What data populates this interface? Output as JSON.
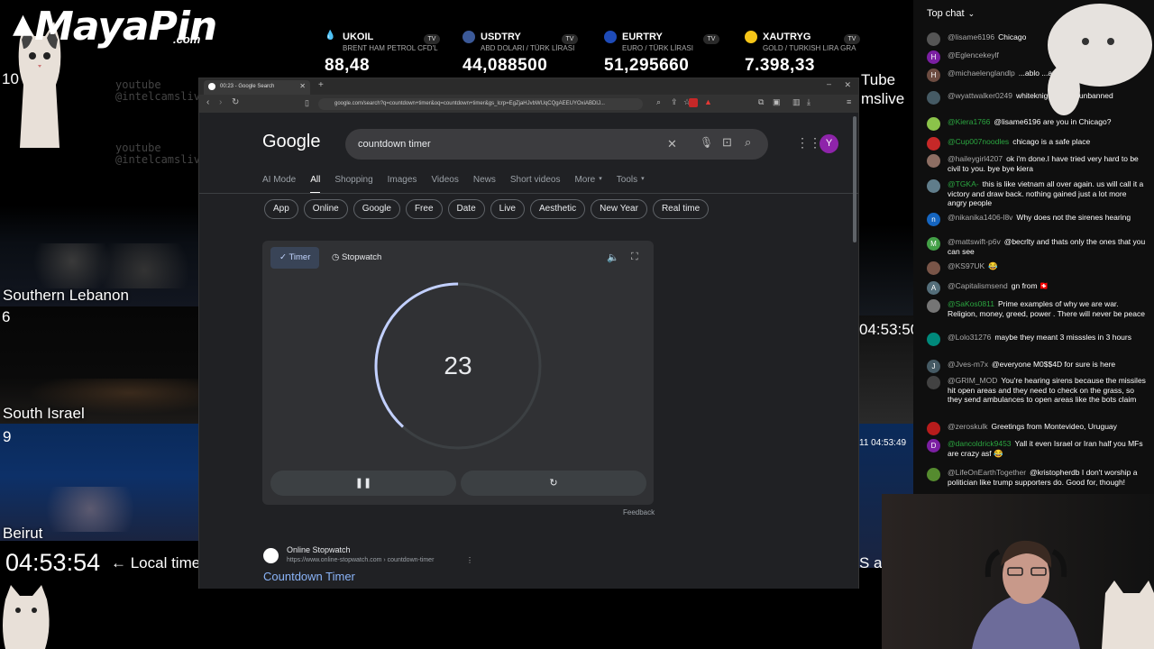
{
  "branding": {
    "logo": "MayaPin",
    "logo_suffix": ".com"
  },
  "ticker": [
    {
      "symbol": "UKOIL",
      "subtitle": "BRENT HAM PETROL CFD'L",
      "value": "88,48",
      "icon": "oil-drop-icon"
    },
    {
      "symbol": "USDTRY",
      "subtitle": "ABD DOLARI / TÜRK LİRASI",
      "value": "44,088500",
      "icon": "usd-try-flag-icon"
    },
    {
      "symbol": "EURTRY",
      "subtitle": "EURO / TÜRK LİRASI",
      "value": "51,295660",
      "icon": "eur-try-flag-icon"
    },
    {
      "symbol": "XAUTRYG",
      "subtitle": "GOLD / TURKISH LIRA GRA",
      "value": "7.398,33",
      "icon": "gold-coin-icon"
    }
  ],
  "cams": {
    "left_top_number": "10",
    "southern_lebanon": {
      "label": "Southern Lebanon",
      "number": "6"
    },
    "south_israel": {
      "label": "South Israel",
      "number": "9"
    },
    "beirut": {
      "label": "Beirut"
    },
    "local_time": "04:53:54",
    "local_time_label": "← Local time",
    "right_time_1": "04:53:50",
    "right_time_2": "11 04:53:49",
    "right_tube_text": "Tube",
    "right_live_text": "mslive",
    "right_bottom_text": "S a",
    "watermark": "youtube\n@intelcamslive"
  },
  "chat": {
    "header": "Top chat",
    "messages": [
      {
        "author": "@lisame6196",
        "text": "Chicago",
        "avatar": "",
        "color": "#555"
      },
      {
        "author": "@Eglencekeylf",
        "text": "",
        "avatar": "H",
        "color": "#7b1fa2"
      },
      {
        "author": "@michaelenglandlp",
        "text": "...ablo ...av-g6ln",
        "avatar": "H",
        "color": "#6d4c41"
      },
      {
        "author": "@wyattwalker0249",
        "text": "whiteknights k... n unbanned",
        "avatar": "",
        "color": "#455a64"
      },
      {
        "author": "@Kiera1766",
        "text": "@lisame6196 are you in Chicago?",
        "avatar": "",
        "color": "#8bc34a",
        "author_color": "#2ba640"
      },
      {
        "author": "@Cup007noodles",
        "text": "chicago is a safe place",
        "avatar": "",
        "color": "#c62828",
        "author_color": "#2ba640"
      },
      {
        "author": "@haileygirl4207",
        "text": "ok i'm done.I have tried very hard to be civil to you. bye bye kiera",
        "avatar": "",
        "color": "#8d6e63"
      },
      {
        "author": "@TGKA-",
        "text": "this is like vietnam all over again. us will call it a victory and draw back. nothing gained just a lot more angry people",
        "avatar": "",
        "color": "#607d8b",
        "author_color": "#2ba640"
      },
      {
        "author": "@nikanika1406-l8v",
        "text": "Why does not the sirenes hearing",
        "avatar": "n",
        "color": "#1565c0"
      },
      {
        "author": "@mattswift-p6v",
        "text": "@becrlty and thats only the ones that you can see",
        "avatar": "M",
        "color": "#43a047"
      },
      {
        "author": "@KS97UK",
        "text": "😂",
        "avatar": "",
        "color": "#795548"
      },
      {
        "author": "@Capitalismsend",
        "text": "gn from 🇨🇭",
        "avatar": "A",
        "color": "#546e7a"
      },
      {
        "author": "@SaKos0811",
        "text": "Prime examples of why we are war. Religion, money, greed, power . There will never be peace",
        "avatar": "",
        "color": "#757575",
        "author_color": "#2ba640"
      },
      {
        "author": "@Lolo31276",
        "text": "maybe they meant 3 misssles in 3 hours",
        "avatar": "",
        "color": "#00897b"
      },
      {
        "author": "@Jves-m7x",
        "text": "@everyone M0$$4D for sure is here",
        "avatar": "J",
        "color": "#455a64"
      },
      {
        "author": "@GRIM_MOD",
        "text": "You're hearing sirens because the missiles hit open areas and they need to check on the grass, so they send ambulances to open areas like the bots claim",
        "avatar": "",
        "color": "#424242"
      },
      {
        "author": "@zeroskulk",
        "text": "Greetings from Montevideo, Uruguay",
        "avatar": "",
        "color": "#b71c1c"
      },
      {
        "author": "@dancoldrick9453",
        "text": "Yall it even Israel or Iran half you MFs are crazy asf 😂",
        "avatar": "D",
        "color": "#7b1fa2",
        "author_color": "#2ba640"
      },
      {
        "author": "@LifeOnEarthTogether",
        "text": "@kristopherdb I don't worship a politician like trump supporters do. Good for, though!",
        "avatar": "",
        "color": "#558b2f"
      }
    ]
  },
  "browser": {
    "tab_title": "00:23 - Google Search",
    "url": "google.com/search?q=countdown+timer&oq=countdown+timer&gs_lcrp=EgZjaHJvbWUqCQgAEEUYOxiABDIJ...",
    "google_logo": "Google",
    "query": "countdown timer",
    "avatar_letter": "Y",
    "nav_tabs": [
      "AI Mode",
      "All",
      "Shopping",
      "Images",
      "Videos",
      "News",
      "Short videos",
      "More",
      "Tools"
    ],
    "chips": [
      "App",
      "Online",
      "Google",
      "Free",
      "Date",
      "Live",
      "Aesthetic",
      "New Year",
      "Real time"
    ],
    "timer": {
      "tab_timer": "Timer",
      "tab_stopwatch": "Stopwatch",
      "value": "23",
      "progress": 0.383
    },
    "feedback": "Feedback",
    "result": {
      "site": "Online Stopwatch",
      "url": "https://www.online-stopwatch.com › countdown-timer",
      "title": "Countdown Timer"
    }
  }
}
